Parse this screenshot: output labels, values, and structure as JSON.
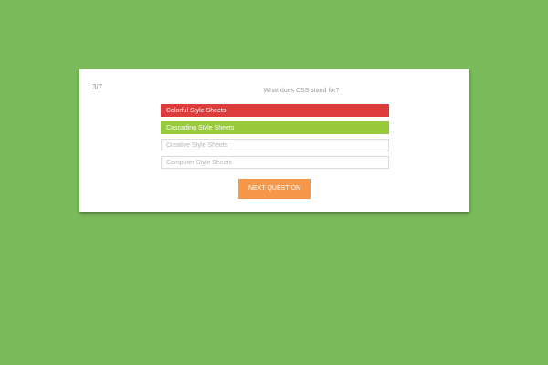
{
  "quiz": {
    "counter": "3/7",
    "question": "What does CSS stand for?",
    "answers": [
      {
        "label": "Colorful Style Sheets",
        "state": "wrong"
      },
      {
        "label": "Cascading Style Sheets",
        "state": "correct"
      },
      {
        "label": "Creative Style Sheets",
        "state": "default"
      },
      {
        "label": "Computer Style Sheets",
        "state": "default"
      }
    ],
    "next_label": "NEXT QUESTION"
  },
  "colors": {
    "background": "#7aba5a",
    "wrong": "#dd3c3c",
    "correct": "#98c93a",
    "button": "#f7974a"
  }
}
